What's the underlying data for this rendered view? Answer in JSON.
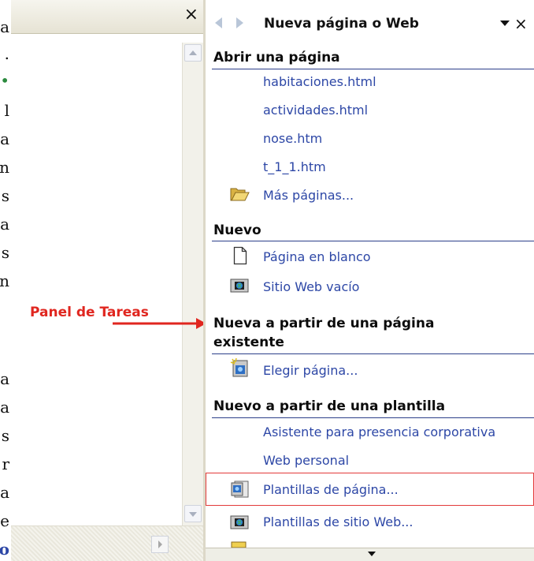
{
  "left_document": {
    "letters": [
      "a",
      ".",
      "l",
      "a",
      "n",
      "s",
      "a",
      "s",
      "n",
      "a",
      "a",
      "s",
      "r",
      "a",
      "e",
      "o"
    ]
  },
  "left_pane": {
    "close_glyph": "×"
  },
  "annotation": {
    "label": "Panel de Tareas"
  },
  "task_pane": {
    "title": "Nueva página o Web",
    "close_glyph": "×",
    "sections": {
      "open": {
        "heading": "Abrir una página",
        "files": [
          "habitaciones.html",
          "actividades.html",
          "nose.htm",
          "t_1_1.htm"
        ],
        "more": "Más páginas..."
      },
      "new": {
        "heading": "Nuevo",
        "blank_page": "Página en blanco",
        "empty_site": "Sitio Web vacío"
      },
      "from_existing": {
        "heading_line1": "Nueva a partir de una página",
        "heading_line2": "existente",
        "choose": "Elegir página..."
      },
      "from_template": {
        "heading": "Nuevo a partir de una plantilla",
        "corporate": "Asistente para presencia corporativa",
        "personal": "Web personal",
        "page_templates": "Plantillas de página...",
        "site_templates": "Plantillas de sitio Web..."
      }
    },
    "icons": {
      "back": "back-arrow-icon",
      "forward": "forward-arrow-icon",
      "folder": "open-folder-icon",
      "blank_page": "blank-page-icon",
      "site": "web-site-icon",
      "choose_page": "choose-page-icon",
      "page_template": "page-template-icon"
    },
    "colors": {
      "link": "#2d47a6",
      "annotation": "#e0261f",
      "highlight_border": "#e23a3a"
    }
  }
}
